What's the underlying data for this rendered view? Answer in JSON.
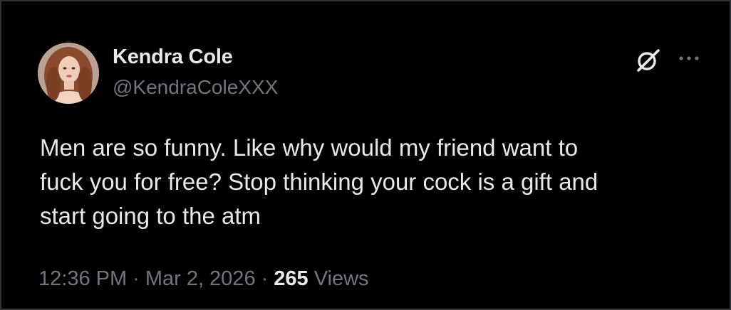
{
  "author": {
    "display_name": "Kendra Cole",
    "handle": "@KendraColeXXX",
    "avatar_icon": "profile-photo"
  },
  "tweet": {
    "text": "Men are so funny. Like why would my friend want to\nfuck you for free? Stop thinking your cock is a gift and\nstart going to the atm"
  },
  "meta": {
    "time": "12:36 PM",
    "date": "Mar 2, 2026",
    "separator": "·",
    "views_count": "265",
    "views_label": "Views"
  },
  "icons": {
    "grok": "grok-icon",
    "more": "more-options-icon"
  },
  "colors": {
    "background": "#000000",
    "primary_text": "#e7e9ea",
    "secondary_text": "#71767b",
    "border": "#2f3336"
  }
}
